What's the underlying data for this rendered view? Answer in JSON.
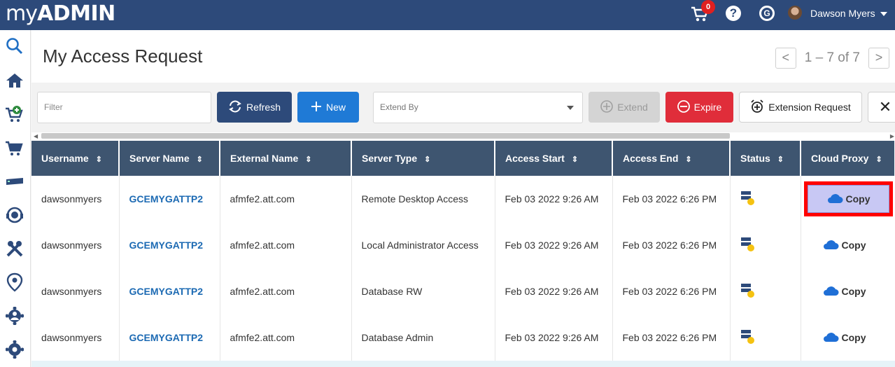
{
  "app": {
    "logo_my": "my",
    "logo_admin": "ADMIN"
  },
  "header": {
    "cart_count": "0",
    "help_label": "?",
    "g_label": "G",
    "user_name": "Dawson Myers"
  },
  "page": {
    "title": "My Access Request"
  },
  "pager": {
    "range": "1 – 7 of 7",
    "prev": "<",
    "next": ">"
  },
  "toolbar": {
    "filter_placeholder": "Filter",
    "refresh_label": "Refresh",
    "new_label": "New",
    "extend_by_placeholder": "Extend By",
    "extend_label": "Extend",
    "expire_label": "Expire",
    "extension_request_label": "Extension Request",
    "close_label": "✕"
  },
  "table": {
    "columns": [
      "Username",
      "Server Name",
      "External Name",
      "Server Type",
      "Access Start",
      "Access End",
      "Status",
      "Cloud Proxy"
    ],
    "rows": [
      {
        "username": "dawsonmyers",
        "server": "GCEMYGATTP2",
        "external": "afmfe2.att.com",
        "type": "Remote Desktop Access",
        "start": "Feb 03 2022 9:26 AM",
        "end": "Feb 03 2022 6:26 PM",
        "proxy": "Copy"
      },
      {
        "username": "dawsonmyers",
        "server": "GCEMYGATTP2",
        "external": "afmfe2.att.com",
        "type": "Local Administrator Access",
        "start": "Feb 03 2022 9:26 AM",
        "end": "Feb 03 2022 6:26 PM",
        "proxy": "Copy"
      },
      {
        "username": "dawsonmyers",
        "server": "GCEMYGATTP2",
        "external": "afmfe2.att.com",
        "type": "Database RW",
        "start": "Feb 03 2022 9:26 AM",
        "end": "Feb 03 2022 6:26 PM",
        "proxy": "Copy"
      },
      {
        "username": "dawsonmyers",
        "server": "GCEMYGATTP2",
        "external": "afmfe2.att.com",
        "type": "Database Admin",
        "start": "Feb 03 2022 9:26 AM",
        "end": "Feb 03 2022 6:26 PM",
        "proxy": "Copy"
      }
    ]
  },
  "colors": {
    "header_bg": "#2d4a7a",
    "table_header_bg": "#3e5570",
    "link": "#1c6ab3",
    "highlight_border": "#ff0000"
  },
  "sidebar_icons": [
    "search-icon",
    "home-icon",
    "cart-add-icon",
    "cart-icon",
    "server-icon",
    "support-agent-icon",
    "tools-icon",
    "location-icon",
    "group-gear-icon",
    "settings-gear-icon"
  ]
}
